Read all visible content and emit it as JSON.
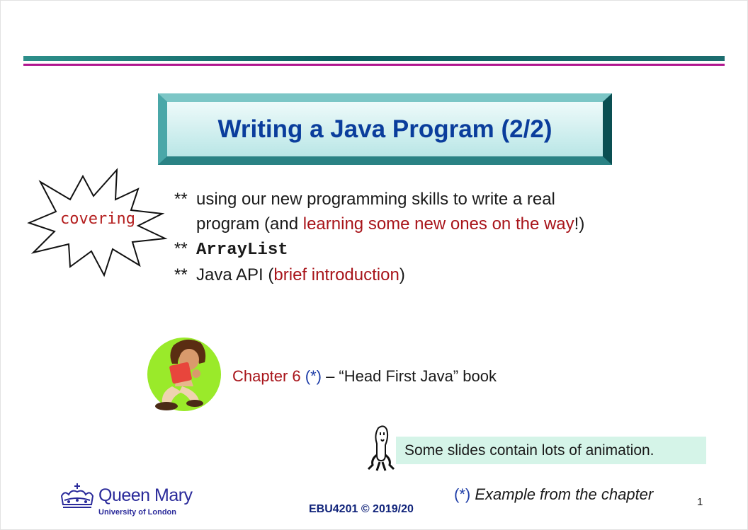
{
  "slide": {
    "title": "Writing a Java Program (2/2)",
    "burst_label": "covering",
    "bullet_marker": "**",
    "bullets": [
      {
        "part1": "using our new programming skills to write a real program (and ",
        "highlight": "learning some new ones on the way",
        "part2": "!)"
      },
      {
        "code": "ArrayList"
      },
      {
        "part1": "Java API (",
        "highlight": "brief introduction",
        "part2": ")"
      }
    ],
    "chapter": {
      "label": "Chapter 6",
      "marker": "(*)",
      "rest": " – “Head First Java” book"
    },
    "animation_note": "Some slides contain lots of animation.",
    "example_note": {
      "marker": "(*)",
      "text": "Example from the chapter"
    },
    "footer": {
      "university": "Queen Mary",
      "university_sub": "University of London",
      "course_code": "EBU4201 © 2019/20",
      "page_number": "1"
    }
  },
  "colors": {
    "title": "#0a3d9c",
    "highlight": "#a8141a",
    "teal_bar": "#0b5e60",
    "magenta_bar": "#b0168f",
    "note_bg": "#d5f4e8"
  }
}
